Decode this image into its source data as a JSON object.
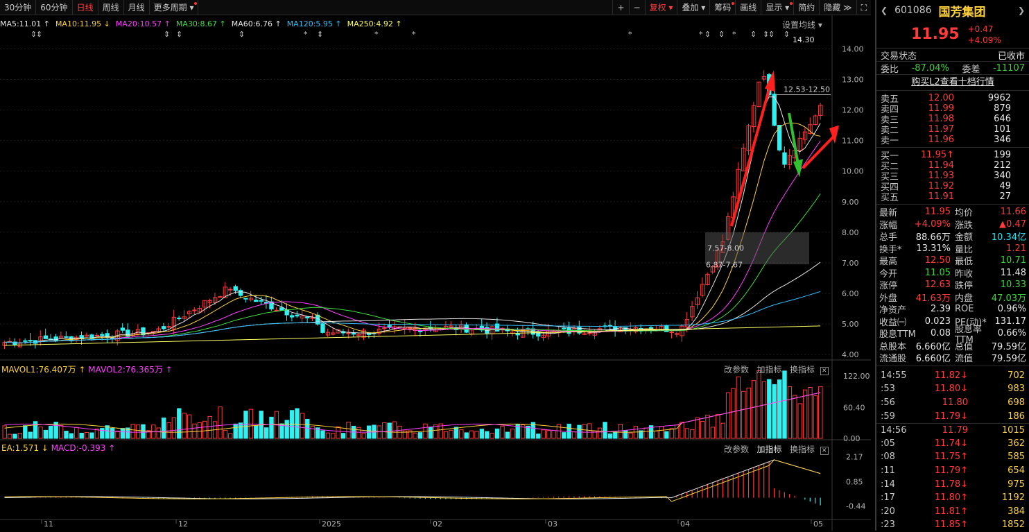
{
  "toolbar": {
    "periods": [
      "30分钟",
      "60分钟",
      "日线",
      "周线",
      "月线",
      "更多周期"
    ],
    "active_period": "日线",
    "buttons": [
      {
        "label": "+",
        "color": "default"
      },
      {
        "label": "−",
        "color": "default"
      },
      {
        "label": "复权",
        "color": "red"
      },
      {
        "label": "叠加",
        "color": "default"
      },
      {
        "label": "筹码",
        "color": "default"
      },
      {
        "label": "画线",
        "color": "default"
      },
      {
        "label": "显示",
        "color": "default"
      },
      {
        "label": "简约",
        "color": "default"
      },
      {
        "label": "隐藏",
        "color": "default"
      }
    ]
  },
  "ma_legend": [
    {
      "label": "MA5:11.01",
      "arrow": "↑",
      "color": "#e6e6e6"
    },
    {
      "label": "MA10:11.95",
      "arrow": "↓",
      "color": "#ffd23a"
    },
    {
      "label": "MA20:10.57",
      "arrow": "↑",
      "color": "#ff40ff"
    },
    {
      "label": "MA30:8.67",
      "arrow": "↑",
      "color": "#40e040"
    },
    {
      "label": "MA60:6.76",
      "arrow": "↑",
      "color": "#e6e6e6"
    },
    {
      "label": "MA120:5.95",
      "arrow": "↑",
      "color": "#30c0ff"
    },
    {
      "label": "MA250:4.92",
      "arrow": "↑",
      "color": "#ffff60"
    }
  ],
  "ma_settings_label": "设置均线",
  "price_annotations": {
    "high": "14.30",
    "box_top_label": "12.53-12.50",
    "box_mid_label": "7.57-8.00",
    "box_low_label": "6.87-7.67"
  },
  "price_axis": [
    "14.00",
    "13.00",
    "12.00",
    "11.00",
    "10.00",
    "9.00",
    "8.00",
    "7.00",
    "6.00",
    "5.00",
    "4.00"
  ],
  "volume_panel": {
    "legend1": "MAVOL1:76.407万",
    "legend2": "MAVOL2:76.365万",
    "actions": [
      "改参数",
      "加指标",
      "换指标"
    ],
    "axis": [
      "122.00",
      "60.40",
      "0.00"
    ]
  },
  "macd_panel": {
    "legend1": "EA:1.571",
    "legend2": "MACD:-0.393",
    "actions": [
      "改参数",
      "加指标",
      "换指标"
    ],
    "axis": [
      "2.17",
      "0.85",
      "-0.44"
    ]
  },
  "x_axis": [
    "11",
    "12",
    "2025",
    "02",
    "03",
    "04",
    "05"
  ],
  "quote": {
    "code": "601086",
    "name": "国芳集团",
    "price": "11.95",
    "change": "+0.47",
    "change_pct": "+4.09%",
    "trade_status_label": "交易状态",
    "trade_status": "已收市",
    "weibi_label": "委比",
    "weibi": "-87.04%",
    "weicha_label": "委差",
    "weicha": "-11107",
    "l2_link": "购买L2查看十档行情",
    "asks": [
      {
        "label": "卖五",
        "price": "12.00",
        "vol": "9962"
      },
      {
        "label": "卖四",
        "price": "11.99",
        "vol": "879"
      },
      {
        "label": "卖三",
        "price": "11.98",
        "vol": "646"
      },
      {
        "label": "卖二",
        "price": "11.97",
        "vol": "101"
      },
      {
        "label": "卖一",
        "price": "11.96",
        "vol": "346"
      }
    ],
    "bids": [
      {
        "label": "买一",
        "price": "11.95↑",
        "vol": "199"
      },
      {
        "label": "买二",
        "price": "11.94",
        "vol": "212"
      },
      {
        "label": "买三",
        "price": "11.93",
        "vol": "340"
      },
      {
        "label": "买四",
        "price": "11.92",
        "vol": "49"
      },
      {
        "label": "买五",
        "price": "11.91",
        "vol": "27"
      }
    ],
    "stats": [
      {
        "l": "最新",
        "v": "11.95",
        "vc": "red",
        "l2": "均价",
        "v2": "11.66",
        "v2c": "red"
      },
      {
        "l": "涨幅",
        "v": "+4.09%",
        "vc": "red",
        "l2": "涨跌",
        "v2": "▲0.47",
        "v2c": "red"
      },
      {
        "l": "总手",
        "v": "88.66万",
        "vc": "white",
        "l2": "金额",
        "v2": "10.34亿",
        "v2c": "cyan"
      },
      {
        "l": "换手*",
        "v": "13.31%",
        "vc": "white",
        "l2": "量比",
        "v2": "1.21",
        "v2c": "red"
      },
      {
        "l": "最高",
        "v": "12.50",
        "vc": "red",
        "l2": "最低",
        "v2": "10.71",
        "v2c": "green"
      },
      {
        "l": "今开",
        "v": "11.05",
        "vc": "green",
        "l2": "昨收",
        "v2": "11.48",
        "v2c": "white"
      },
      {
        "l": "涨停",
        "v": "12.63",
        "vc": "red",
        "l2": "跌停",
        "v2": "10.33",
        "v2c": "green"
      },
      {
        "l": "外盘",
        "v": "41.63万",
        "vc": "red",
        "l2": "内盘",
        "v2": "47.03万",
        "v2c": "green"
      },
      {
        "l": "净资产",
        "v": "2.39",
        "vc": "white",
        "l2": "ROE",
        "v2": "0.96%",
        "v2c": "white"
      },
      {
        "l": "收益㈠",
        "v": "0.023",
        "vc": "white",
        "l2": "PE(动)*",
        "v2": "131.17",
        "v2c": "white"
      },
      {
        "l": "股息TTM",
        "v": "0.08",
        "vc": "white",
        "l2": "股息率TTM",
        "v2": "0.66%",
        "v2c": "white"
      },
      {
        "l": "总股本",
        "v": "6.660亿",
        "vc": "white",
        "l2": "总值",
        "v2": "79.59亿",
        "v2c": "white"
      },
      {
        "l": "流通股",
        "v": "6.660亿",
        "vc": "white",
        "l2": "流值",
        "v2": "79.59亿",
        "v2c": "white"
      }
    ],
    "ticks": [
      {
        "t": "14:55",
        "p": "11.82↓",
        "pc": "red",
        "v": "702"
      },
      {
        "t": ":53",
        "p": "11.80↓",
        "pc": "red",
        "v": "983"
      },
      {
        "t": ":56",
        "p": "11.80",
        "pc": "red",
        "v": "698"
      },
      {
        "t": ":59",
        "p": "11.79↓",
        "pc": "red",
        "v": "186"
      },
      {
        "t": "14:56",
        "p": "11.79",
        "pc": "red",
        "v": "1015"
      },
      {
        "t": ":05",
        "p": "11.74↓",
        "pc": "red",
        "v": "362"
      },
      {
        "t": ":08",
        "p": "11.75↑",
        "pc": "red",
        "v": "585"
      },
      {
        "t": ":11",
        "p": "11.79↑",
        "pc": "red",
        "v": "654"
      },
      {
        "t": ":14",
        "p": "11.78↓",
        "pc": "red",
        "v": "975"
      },
      {
        "t": ":17",
        "p": "11.80↑",
        "pc": "red",
        "v": "1192"
      },
      {
        "t": ":20",
        "p": "11.81↑",
        "pc": "red",
        "v": "384"
      },
      {
        "t": ":23",
        "p": "11.85↑",
        "pc": "red",
        "v": "1852"
      }
    ]
  },
  "colors": {
    "up": "#ff3b3b",
    "down": "#30f0f0",
    "bg": "#000000",
    "grid": "#2a2a2a"
  }
}
